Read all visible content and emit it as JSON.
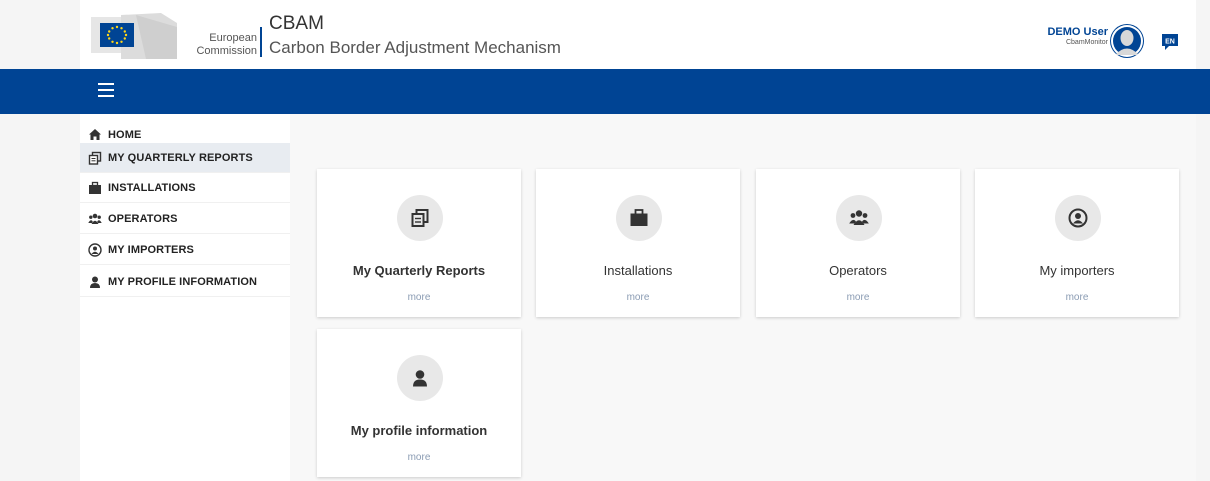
{
  "header": {
    "ec_line1": "European",
    "ec_line2": "Commission",
    "app_title": "CBAM",
    "app_subtitle": "Carbon Border Adjustment Mechanism",
    "user_name": "DEMO User",
    "user_role": "CbamMonitor",
    "language": "EN"
  },
  "sidebar": {
    "items": [
      {
        "label": "HOME",
        "icon": "home-icon"
      },
      {
        "label": "MY QUARTERLY REPORTS",
        "icon": "reports-icon"
      },
      {
        "label": "INSTALLATIONS",
        "icon": "briefcase-icon"
      },
      {
        "label": "OPERATORS",
        "icon": "users-icon"
      },
      {
        "label": "MY IMPORTERS",
        "icon": "user-circle-icon"
      },
      {
        "label": "MY PROFILE INFORMATION",
        "icon": "user-icon"
      }
    ],
    "active_index": 1
  },
  "tiles": [
    {
      "title": "My Quarterly Reports",
      "more": "more",
      "icon": "reports-icon"
    },
    {
      "title": "Installations",
      "more": "more",
      "icon": "briefcase-icon"
    },
    {
      "title": "Operators",
      "more": "more",
      "icon": "users-icon"
    },
    {
      "title": "My importers",
      "more": "more",
      "icon": "user-circle-icon"
    },
    {
      "title": "My profile information",
      "more": "more",
      "icon": "user-icon"
    }
  ],
  "colors": {
    "brand_blue": "#004494",
    "flag_yellow": "#ffd617"
  }
}
